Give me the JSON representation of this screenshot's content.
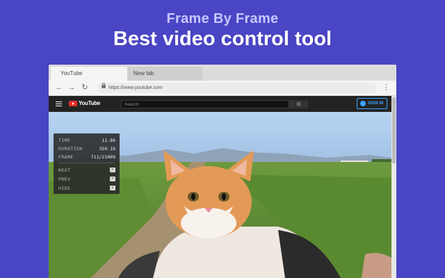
{
  "promo": {
    "subtitle": "Frame By Frame",
    "title": "Best video control tool"
  },
  "browser": {
    "tabs": [
      {
        "label": "YouTube"
      },
      {
        "label": "New tab"
      }
    ],
    "url": "https://www.youtube.com"
  },
  "youtube": {
    "logo_text": "YouTube",
    "search_placeholder": "Search",
    "signin_label": "SIGN IN"
  },
  "frame_panel": {
    "time_label": "TIME",
    "time_value": "11.86",
    "duration_label": "DURATION",
    "duration_value": "350.16",
    "frame_label": "FRAME",
    "frame_value": "711/21009",
    "next_label": "NEXT",
    "next_key": ">",
    "prev_label": "PREV",
    "prev_key": "<",
    "hide_label": "HIDE",
    "hide_key": "i"
  },
  "colors": {
    "background": "#4a45c4",
    "accent": "#3ea6ff",
    "youtube_red": "#e52d27"
  },
  "icons": [
    "back-arrow-icon",
    "forward-arrow-icon",
    "reload-icon",
    "lock-icon",
    "more-vert-icon",
    "hamburger-menu-icon",
    "youtube-logo-icon",
    "search-icon",
    "account-icon"
  ]
}
